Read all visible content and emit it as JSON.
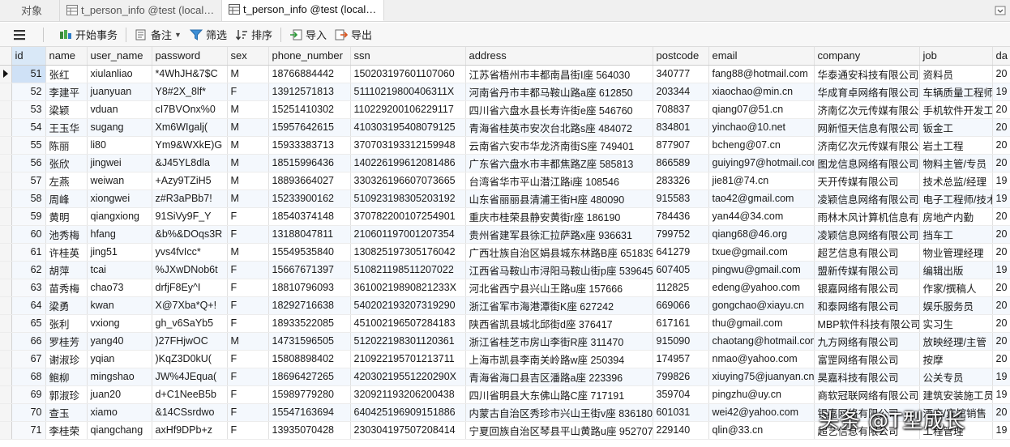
{
  "tabs": [
    {
      "label": "对象",
      "active": false
    },
    {
      "label": "t_person_info @test (localh...",
      "active": false
    },
    {
      "label": "t_person_info @test (localh...",
      "active": true
    }
  ],
  "toolbar": {
    "begin_transaction": "开始事务",
    "note": "备注",
    "filter": "筛选",
    "sort": "排序",
    "import": "导入",
    "export": "导出"
  },
  "columns": [
    "id",
    "name",
    "user_name",
    "password",
    "sex",
    "phone_number",
    "ssn",
    "address",
    "postcode",
    "email",
    "company",
    "job",
    "da"
  ],
  "rows": [
    [
      "51",
      "张红",
      "xiulanliao",
      "*4WhJH&7$C",
      "M",
      "18766884442",
      "150203197601107060",
      "江苏省梧州市丰都南昌街I座 564030",
      "340777",
      "fang88@hotmail.com",
      "华泰通安科技有限公司",
      "资料员",
      "20"
    ],
    [
      "52",
      "李建平",
      "juanyuan",
      "Y8#2X_8lf*",
      "F",
      "13912571813",
      "51110219800406311X",
      "河南省丹市丰都马鞍山路a座 612850",
      "203344",
      "xiaochao@min.cn",
      "华成育卓网络有限公司",
      "车辆质量工程师",
      "19"
    ],
    [
      "53",
      "梁颖",
      "vduan",
      "cI7BVOnx%0",
      "M",
      "15251410302",
      "110229200106229117",
      "四川省六盘水县长寿许街e座 546760",
      "708837",
      "qiang07@51.cn",
      "济南亿次元传媒有限公司",
      "手机软件开发工",
      "20"
    ],
    [
      "54",
      "王玉华",
      "sugang",
      "Xm6WIgalj(",
      "M",
      "15957642615",
      "410303195408079125",
      "青海省桂英市安次台北路s座 484072",
      "834801",
      "yinchao@10.net",
      "网新恒天信息有限公司",
      "钣金工",
      "20"
    ],
    [
      "55",
      "陈丽",
      "li80",
      "Ym9&WXkE)G",
      "M",
      "15933383713",
      "370703193312159948",
      "云南省六安市华龙济南街S座 749401",
      "877907",
      "bcheng@07.cn",
      "济南亿次元传媒有限公司",
      "岩土工程",
      "20"
    ],
    [
      "56",
      "张欣",
      "jingwei",
      "&J45YL8dla",
      "M",
      "18515996436",
      "140226199612081486",
      "广东省六盘水市丰都焦路Z座 585813",
      "866589",
      "guiying97@hotmail.com",
      "图龙信息网络有限公司",
      "物料主管/专员",
      "20"
    ],
    [
      "57",
      "左燕",
      "weiwan",
      "+Azy9TZiH5",
      "M",
      "18893664027",
      "330326196607073665",
      "台湾省华市平山潜江路i座 108546",
      "283326",
      "jie81@74.cn",
      "天开传媒有限公司",
      "技术总监/经理",
      "19"
    ],
    [
      "58",
      "周峰",
      "xiongwei",
      "z#R3aPBb7!",
      "M",
      "15233900162",
      "510923198305203192",
      "山东省丽丽县清浦王街H座 480090",
      "915583",
      "tao42@gmail.com",
      "凌颖信息网络有限公司",
      "电子工程师/技术",
      "19"
    ],
    [
      "59",
      "黄明",
      "qiangxiong",
      "91SiVy9F_Y",
      "F",
      "18540374148",
      "370782200107254901",
      "重庆市桂荣县静安黄街r座 186190",
      "784436",
      "yan44@34.com",
      "雨林木风计算机信息有限",
      "房地产内勤",
      "20"
    ],
    [
      "60",
      "池秀梅",
      "hfang",
      "&b%&DOqs3R",
      "F",
      "13188047811",
      "210601197001207354",
      "贵州省建军县徐汇拉萨路x座 936631",
      "799752",
      "qiang68@46.org",
      "凌颖信息网络有限公司",
      "挡车工",
      "20"
    ],
    [
      "61",
      "许桂英",
      "jing51",
      "yvs4fvIcc*",
      "M",
      "15549535840",
      "130825197305176042",
      "广西壮族自治区娟县城东林路B座 651839",
      "641279",
      "txue@gmail.com",
      "超艺信息有限公司",
      "物业管理经理",
      "20"
    ],
    [
      "62",
      "胡萍",
      "tcai",
      "%JXwDNob6t",
      "F",
      "15667671397",
      "510821198511207022",
      "江西省马鞍山市浔阳马鞍山街p座 539645",
      "607405",
      "pingwu@gmail.com",
      "盟新传媒有限公司",
      "编辑出版",
      "19"
    ],
    [
      "63",
      "苗秀梅",
      "chao73",
      "drfjF8Ey^I",
      "F",
      "18810796093",
      "36100219890821233X",
      "河北省西宁县兴山王路u座 157666",
      "112825",
      "edeng@yahoo.com",
      "银嘉网络有限公司",
      "作家/撰稿人",
      "20"
    ],
    [
      "64",
      "梁勇",
      "kwan",
      "X@7Xba*Q+!",
      "F",
      "18292716638",
      "540202193207319290",
      "浙江省军市海港潭街K座 627242",
      "669066",
      "gongchao@xiayu.cn",
      "和泰网络有限公司",
      "娱乐服务员",
      "20"
    ],
    [
      "65",
      "张利",
      "vxiong",
      "gh_v6SaYb5",
      "F",
      "18933522085",
      "451002196507284183",
      "陕西省凯县城北邱街d座 376417",
      "617161",
      "thu@gmail.com",
      "MBP软件科技有限公司",
      "实习生",
      "20"
    ],
    [
      "66",
      "罗桂芳",
      "yang40",
      ")27FHjwOC",
      "M",
      "14731596505",
      "512022198301120361",
      "浙江省桂芝市房山李街R座 311470",
      "915090",
      "chaotang@hotmail.com",
      "九方网络有限公司",
      "放映经理/主管",
      "20"
    ],
    [
      "67",
      "谢淑珍",
      "yqian",
      ")KqZ3D0kU(",
      "F",
      "15808898402",
      "210922195701213711",
      "上海市凯县李南关岭路w座 250394",
      "174957",
      "nmao@yahoo.com",
      "富罡网络有限公司",
      "按摩",
      "20"
    ],
    [
      "68",
      "鲍柳",
      "mingshao",
      "JW%4JEqua(",
      "F",
      "18696427265",
      "42030219551220290X",
      "青海省海口县吉区潘路a座 223396",
      "799826",
      "xiuying75@juanyan.cn",
      "昊嘉科技有限公司",
      "公关专员",
      "19"
    ],
    [
      "69",
      "郭淑珍",
      "juan20",
      "d+C1NeeB5b",
      "F",
      "15989779280",
      "320921193206200438",
      "四川省明县大东佛山路C座 717191",
      "359704",
      "pingzhu@uy.cn",
      "商软冠联网络有限公司",
      "建筑安装施工员",
      "19"
    ],
    [
      "70",
      "查玉",
      "xiamo",
      "&14CSsrdwo",
      "F",
      "15547163694",
      "640425196909151886",
      "内蒙古自治区秀珍市兴山王街v座 836180",
      "601031",
      "wei42@yahoo.com",
      "银嘉网络有限公司",
      "酒店/宾馆销售",
      "20"
    ],
    [
      "71",
      "李桂荣",
      "qiangchang",
      "axHf9DPb+z",
      "F",
      "13935070428",
      "230304197507208414",
      "宁夏回族自治区琴县平山黄路u座 952707",
      "229140",
      "qlin@33.cn",
      "超艺信息有限公司",
      "工程管理",
      "19"
    ]
  ],
  "watermark": "头条 @T型成长",
  "colors": {
    "accent_selected": "#d9e8f7",
    "row_alt": "#f4f8fd"
  }
}
